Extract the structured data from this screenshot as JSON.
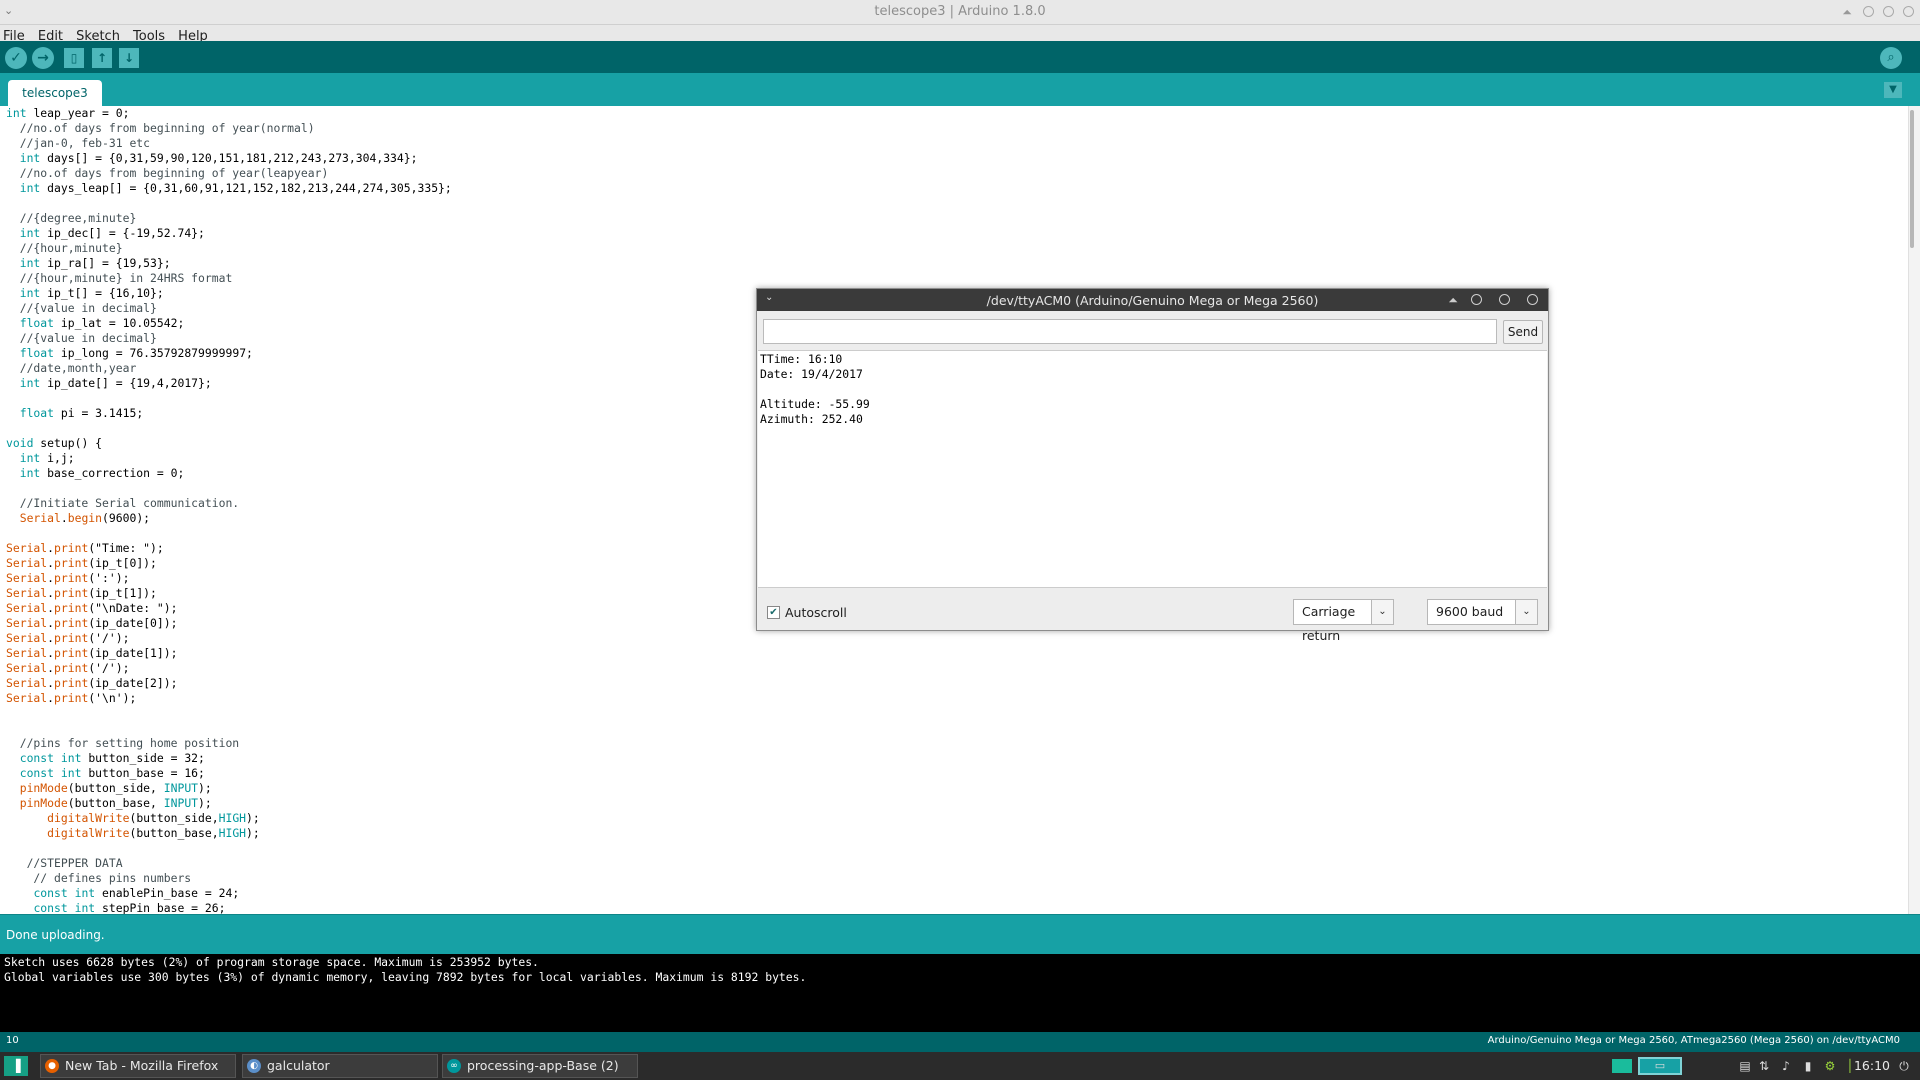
{
  "window": {
    "title": "telescope3 | Arduino 1.8.0"
  },
  "menu": {
    "items": [
      "File",
      "Edit",
      "Sketch",
      "Tools",
      "Help"
    ]
  },
  "toolbar": {
    "buttons": [
      "verify-icon",
      "upload-icon",
      "new-icon",
      "open-icon",
      "save-icon"
    ],
    "serial_monitor_icon": "serial-monitor-icon"
  },
  "tabs": {
    "active": "telescope3"
  },
  "editor": {
    "lines": [
      "int leap_year = 0;",
      "  //no.of days from beginning of year(normal)",
      "  //jan-0, feb-31 etc",
      "  int days[] = {0,31,59,90,120,151,181,212,243,273,304,334};",
      "  //no.of days from beginning of year(leapyear)",
      "  int days_leap[] = {0,31,60,91,121,152,182,213,244,274,305,335};",
      "",
      "  //{degree,minute}",
      "  int ip_dec[] = {-19,52.74};",
      "  //{hour,minute}",
      "  int ip_ra[] = {19,53};",
      "  //{hour,minute} in 24HRS format",
      "  int ip_t[] = {16,10};",
      "  //{value in decimal}",
      "  float ip_lat = 10.05542;",
      "  //{value in decimal}",
      "  float ip_long = 76.35792879999997;",
      "  //date,month,year",
      "  int ip_date[] = {19,4,2017};",
      "",
      "  float pi = 3.1415;",
      "",
      "void setup() {",
      "  int i,j;",
      "  int base_correction = 0;",
      "",
      "  //Initiate Serial communication.",
      "  Serial.begin(9600);",
      "",
      "Serial.print(\"Time: \");",
      "Serial.print(ip_t[0]);",
      "Serial.print(':');",
      "Serial.print(ip_t[1]);",
      "Serial.print(\"\\nDate: \");",
      "Serial.print(ip_date[0]);",
      "Serial.print('/');",
      "Serial.print(ip_date[1]);",
      "Serial.print('/');",
      "Serial.print(ip_date[2]);",
      "Serial.print('\\n');",
      "",
      "",
      "  //pins for setting home position",
      "  const int button_side = 32;",
      "  const int button_base = 16;",
      "  pinMode(button_side, INPUT);",
      "  pinMode(button_base, INPUT);",
      "      digitalWrite(button_side,HIGH);",
      "      digitalWrite(button_base,HIGH);",
      "",
      "   //STEPPER DATA",
      "    // defines pins numbers",
      "    const int enablePin_base = 24;",
      "    const int stepPin_base = 26;"
    ]
  },
  "status": {
    "message": "Done uploading."
  },
  "console": {
    "lines": [
      "Sketch uses 6628 bytes (2%) of program storage space. Maximum is 253952 bytes.",
      "Global variables use 300 bytes (3%) of dynamic memory, leaving 7892 bytes for local variables. Maximum is 8192 bytes."
    ]
  },
  "footer": {
    "line_number": "10",
    "board": "Arduino/Genuino Mega or Mega 2560, ATmega2560 (Mega 2560) on /dev/ttyACM0"
  },
  "serial_monitor": {
    "title": "/dev/ttyACM0 (Arduino/Genuino Mega or Mega 2560)",
    "input_value": "",
    "send_label": "Send",
    "output": [
      "TTime: 16:10",
      "Date: 19/4/2017",
      "",
      "Altitude: -55.99",
      "Azimuth: 252.40"
    ],
    "autoscroll_label": "Autoscroll",
    "autoscroll_checked": true,
    "line_ending": "Carriage return",
    "baud": "9600 baud"
  },
  "taskbar": {
    "tasks": [
      {
        "label": "New Tab - Mozilla Firefox",
        "icon": "firefox-icon"
      },
      {
        "label": "galculator",
        "icon": "galculator-icon"
      },
      {
        "label": "processing-app-Base (2)",
        "icon": "arduino-icon"
      }
    ],
    "clock": "16:10"
  },
  "colors": {
    "arduino_teal_dark": "#006468",
    "arduino_teal": "#17a1a5",
    "keyword": "#00979c",
    "function": "#d35400"
  }
}
